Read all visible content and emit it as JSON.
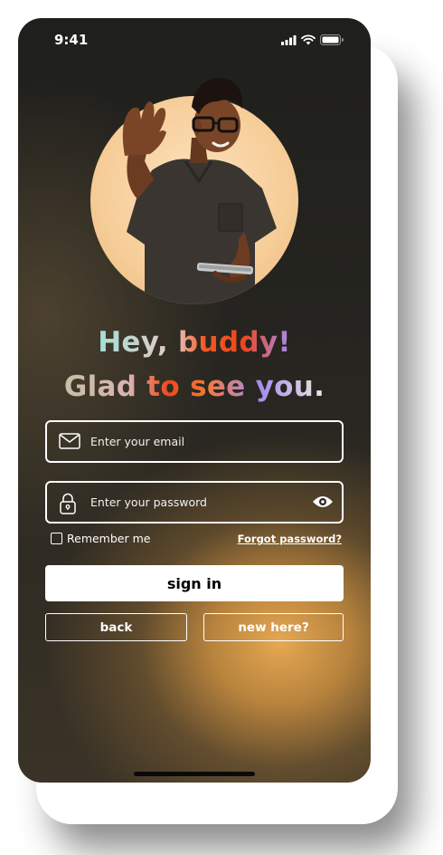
{
  "status_bar": {
    "time": "9:41",
    "icons": [
      "signal-icon",
      "wifi-icon",
      "battery-icon"
    ]
  },
  "avatar": {
    "icon": "waving-person-illustration"
  },
  "headline": {
    "line1": "Hey, buddy!",
    "line2": "Glad to see you."
  },
  "form": {
    "email": {
      "placeholder": "Enter your email",
      "value": "",
      "icon": "mail-icon"
    },
    "password": {
      "placeholder": "Enter your password",
      "value": "",
      "icon": "lock-icon",
      "toggle_icon": "eye-icon"
    },
    "remember_label": "Remember me",
    "remember_checked": false,
    "forgot_label": "Forgot password?"
  },
  "buttons": {
    "signin": "sign in",
    "back": "back",
    "new_here": "new here?"
  },
  "colors": {
    "accent_orange": "#f0451c",
    "accent_purple": "#a68cf0",
    "accent_teal": "#a5dfd6",
    "glow": "#e6a852"
  }
}
